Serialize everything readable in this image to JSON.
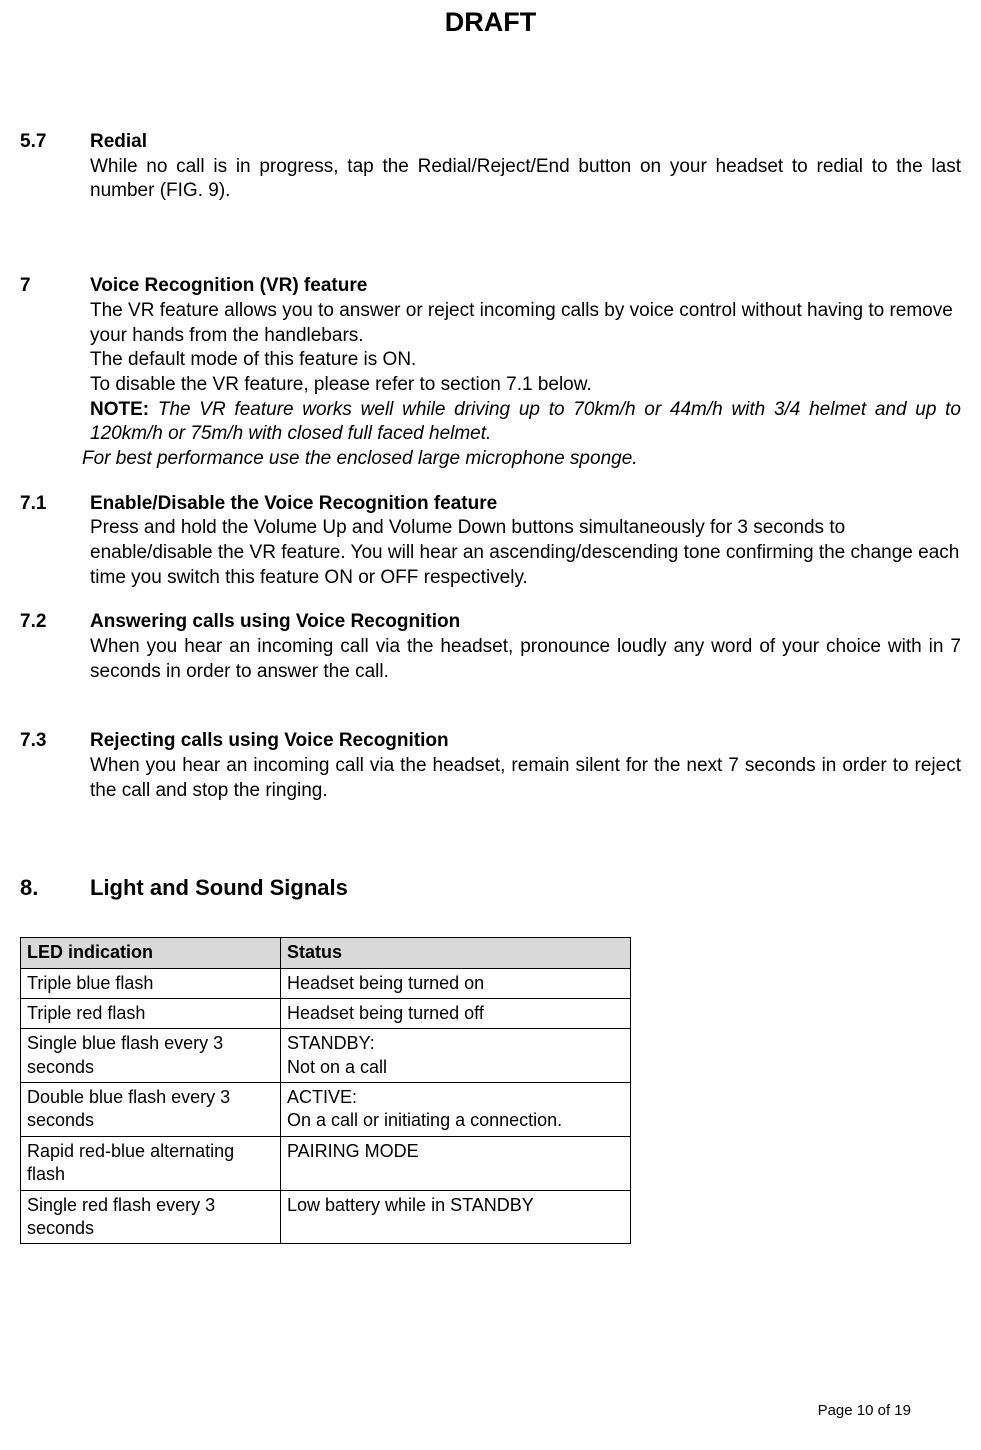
{
  "header": {
    "draft": "DRAFT"
  },
  "sections": {
    "s5_7": {
      "num": "5.7",
      "title": "Redial",
      "body": "While no call is in progress, tap the Redial/Reject/End button on your headset to redial to the last number (FIG. 9)."
    },
    "s7": {
      "num": "7",
      "title": "Voice Recognition (VR) feature",
      "p1": "The VR feature allows you to answer or reject incoming calls by voice control without having to remove your hands from the handlebars.",
      "p2": "The default mode of this feature is ON.",
      "p3": "To disable the VR feature, please refer to section 7.1 below.",
      "note_label": "NOTE: ",
      "note_body": "The VR feature works well while driving up to 70km/h or 44m/h with 3/4 helmet and up to 120km/h or 75m/h with closed full faced helmet.",
      "note_body2": "For best performance use the enclosed large microphone sponge."
    },
    "s7_1": {
      "num": "7.1",
      "title": "Enable/Disable the Voice Recognition feature",
      "body": " Press and hold the Volume Up and Volume Down buttons simultaneously for 3 seconds to enable/disable the VR feature. You will hear an ascending/descending tone confirming the change each time you switch this feature ON or OFF respectively."
    },
    "s7_2": {
      "num": "7.2",
      "title": "Answering calls using Voice Recognition",
      "body": "When you hear an incoming call via the headset, pronounce loudly any word of your choice with in 7 seconds in order to answer the call."
    },
    "s7_3": {
      "num": "7.3",
      "title": "Rejecting calls using Voice Recognition",
      "body": "When you hear an incoming call via the headset, remain silent for the next 7 seconds in order to reject the call and stop the ringing."
    },
    "s8": {
      "num": "8.",
      "title": "Light and Sound Signals"
    }
  },
  "table": {
    "header": [
      "LED indication",
      "Status"
    ],
    "rows": [
      [
        "Triple blue flash",
        "Headset being turned on"
      ],
      [
        "Triple red flash",
        "Headset being turned off"
      ],
      [
        "Single blue flash every 3 seconds",
        "STANDBY:\nNot on a call"
      ],
      [
        "Double blue flash every 3 seconds",
        "ACTIVE:\nOn a call or initiating a connection."
      ],
      [
        "Rapid red-blue alternating flash",
        "PAIRING MODE"
      ],
      [
        "Single red flash every 3 seconds",
        "Low battery while in STANDBY"
      ]
    ]
  },
  "footer": {
    "page": "Page 10 of 19"
  }
}
